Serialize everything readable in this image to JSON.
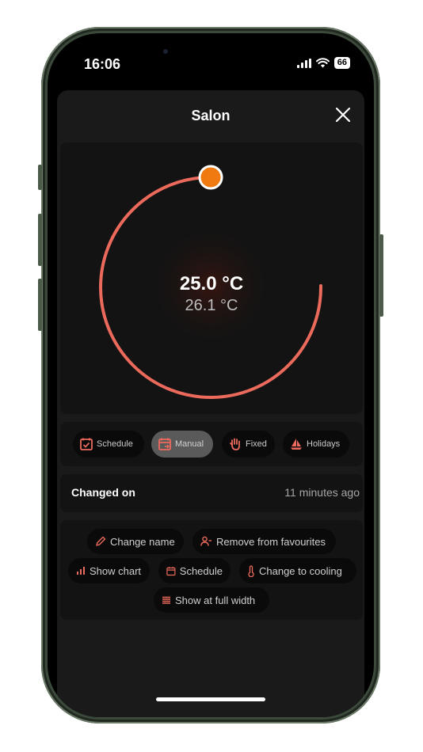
{
  "status_bar": {
    "time": "16:06",
    "battery": "66"
  },
  "header": {
    "title": "Salon"
  },
  "thermostat": {
    "target_temp": "25.0 °C",
    "current_temp": "26.1 °C",
    "accent": "#ec6a5c",
    "handle_color": "#f07a10"
  },
  "modes": [
    {
      "label": "Schedule",
      "icon": "calendar-check-icon",
      "active": false
    },
    {
      "label": "Manual",
      "icon": "calendar-manual-icon",
      "active": true
    },
    {
      "label": "Fixed",
      "icon": "hand-icon",
      "active": false
    },
    {
      "label": "Holidays",
      "icon": "sailboat-icon",
      "active": false
    }
  ],
  "changed": {
    "label": "Changed on",
    "value": "11 minutes ago"
  },
  "actions": [
    {
      "label": "Change name",
      "icon": "pencil-icon"
    },
    {
      "label": "Remove from favourites",
      "icon": "user-minus-icon"
    },
    {
      "label": "Show chart",
      "icon": "bar-chart-icon"
    },
    {
      "label": "Schedule",
      "icon": "calendar-icon"
    },
    {
      "label": "Change to cooling",
      "icon": "thermometer-icon"
    },
    {
      "label": "Show at full width",
      "icon": "full-width-icon"
    }
  ]
}
